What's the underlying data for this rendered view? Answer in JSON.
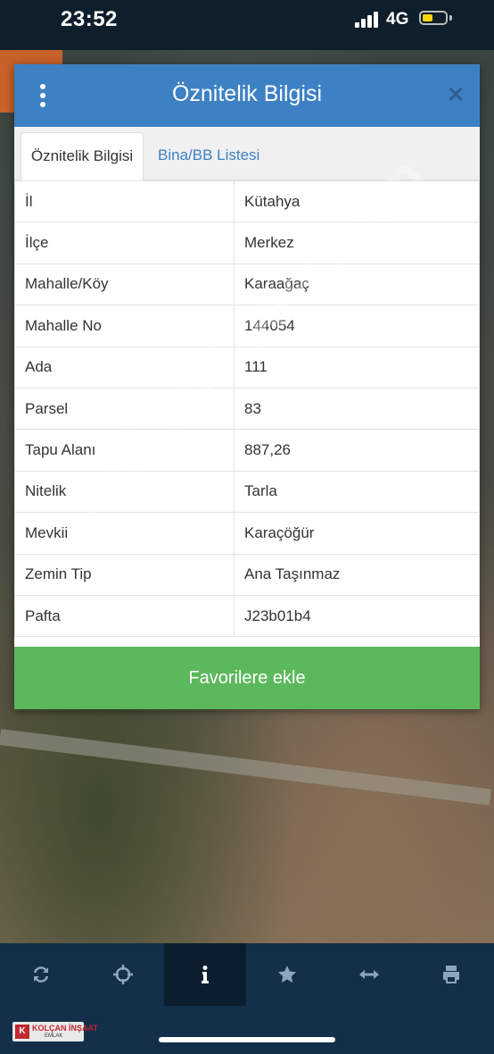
{
  "status_bar": {
    "time": "23:52",
    "network": "4G",
    "battery_level": 0.45,
    "battery_color": "#ffd60a"
  },
  "dialog": {
    "title": "Öznitelik Bilgisi",
    "header_color": "#3d81c4",
    "menu_icon": "vertical-dots-icon",
    "close_icon": "close-icon",
    "tabs": [
      {
        "label": "Öznitelik Bilgisi",
        "active": true
      },
      {
        "label": "Bina/BB Listesi",
        "active": false
      }
    ],
    "rows": [
      {
        "label": "İl",
        "value": "Kütahya"
      },
      {
        "label": "İlçe",
        "value": "Merkez"
      },
      {
        "label": "Mahalle/Köy",
        "value": "Karaağaç"
      },
      {
        "label": "Mahalle No",
        "value": "144054"
      },
      {
        "label": "Ada",
        "value": "111"
      },
      {
        "label": "Parsel",
        "value": "83"
      },
      {
        "label": "Tapu Alanı",
        "value": "887,26"
      },
      {
        "label": "Nitelik",
        "value": "Tarla"
      },
      {
        "label": "Mevkii",
        "value": "Karaçöğür"
      },
      {
        "label": "Zemin Tip",
        "value": "Ana Taşınmaz"
      },
      {
        "label": "Pafta",
        "value": "J23b01b4"
      }
    ],
    "favorite_button": "Favorilere ekle",
    "favorite_color": "#5cb85c"
  },
  "watermark": "DLCemlakiet.com",
  "toolbar": {
    "items": [
      {
        "icon": "refresh-icon",
        "active": false
      },
      {
        "icon": "crosshair-icon",
        "active": false
      },
      {
        "icon": "info-icon",
        "active": true
      },
      {
        "icon": "star-icon",
        "active": false
      },
      {
        "icon": "horizontal-arrows-icon",
        "active": false
      },
      {
        "icon": "printer-icon",
        "active": false
      }
    ]
  },
  "logo": {
    "text": "KOLÇAN İNŞAAT",
    "sub": "EMLAK",
    "mark": "K"
  }
}
